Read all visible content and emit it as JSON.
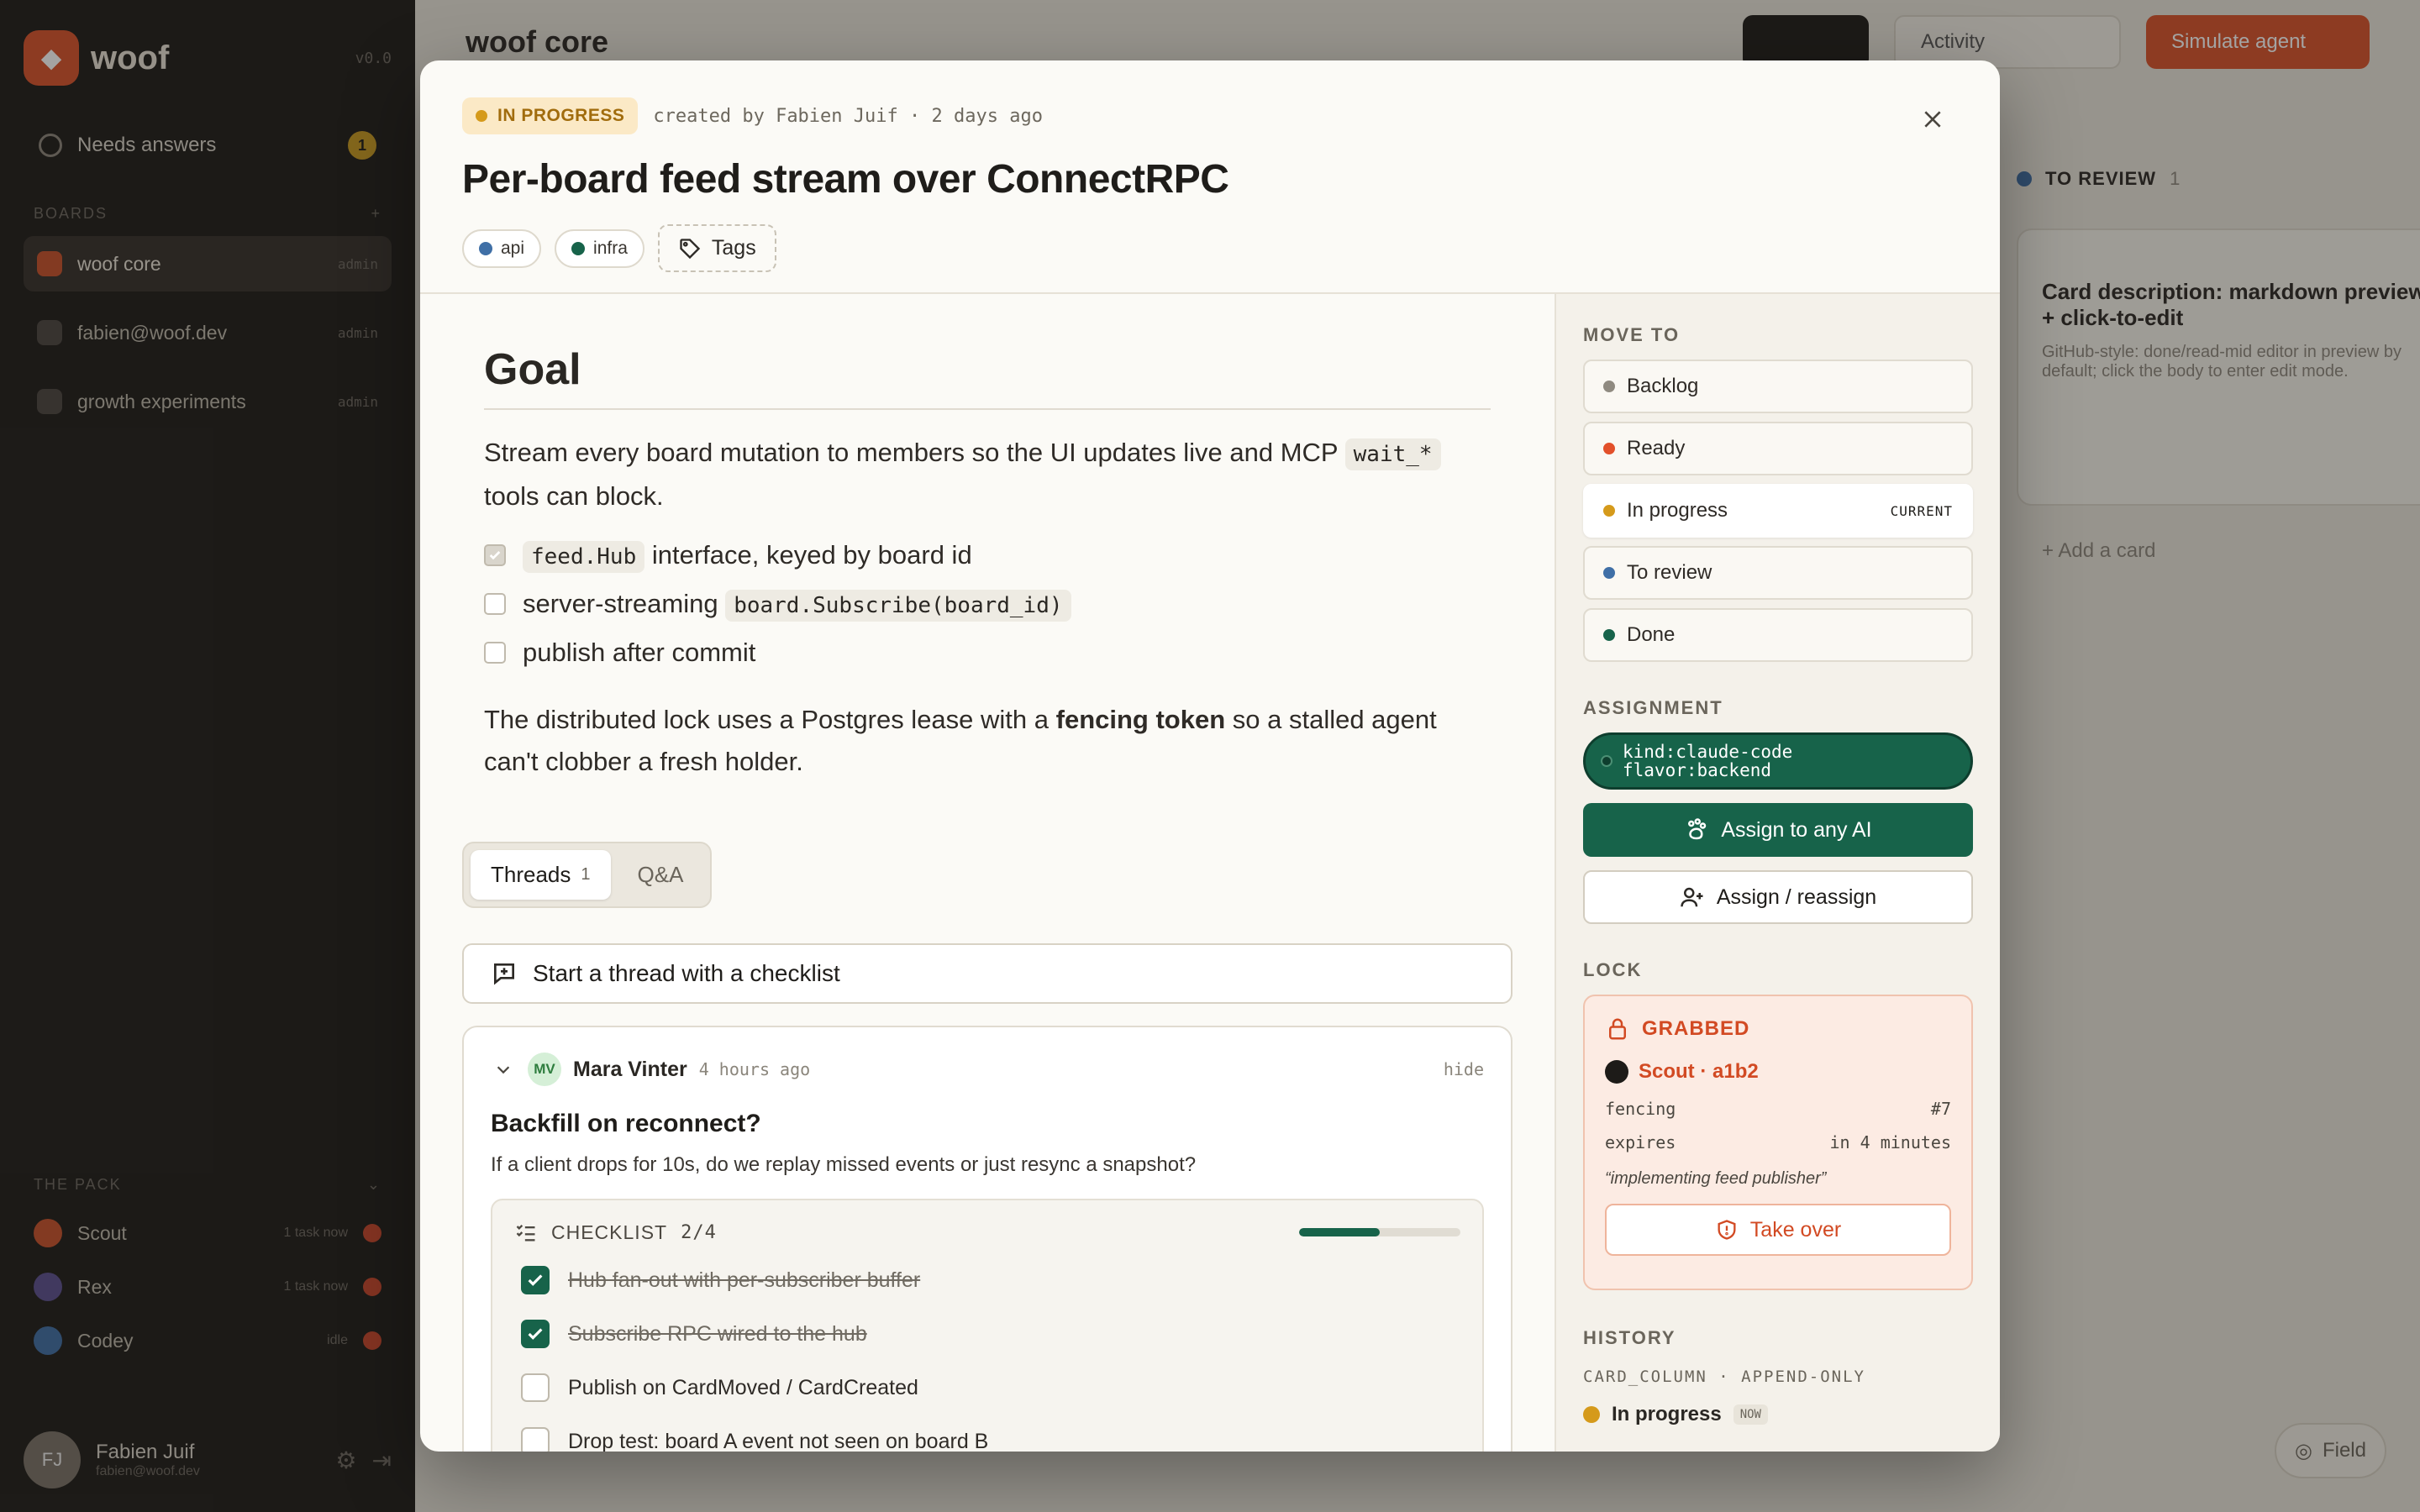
{
  "background": {
    "brand": {
      "name": "woof",
      "version": "v0.0"
    },
    "needs_answers": {
      "label": "Needs answers",
      "count": "1"
    },
    "boards_section": {
      "label": "BOARDS",
      "add": "+"
    },
    "boards": [
      {
        "name": "woof core",
        "meta": "admin",
        "active": true
      },
      {
        "name": "fabien@woof.dev",
        "meta": "admin",
        "active": false
      },
      {
        "name": "growth experiments",
        "meta": "admin",
        "active": false
      }
    ],
    "pack": {
      "label": "THE PACK",
      "agents": [
        {
          "name": "Scout",
          "status": "1 task now",
          "color": "#c8512b"
        },
        {
          "name": "Rex",
          "status": "1 task now",
          "color": "#5a4f8f"
        },
        {
          "name": "Codey",
          "status": "idle",
          "color": "#3f6fa6"
        }
      ]
    },
    "user": {
      "initials": "FJ",
      "name": "Fabien Juif",
      "email": "fabien@woof.dev"
    },
    "topbar": {
      "title": "woof core",
      "activity": "Activity",
      "simulate": "Simulate agent"
    },
    "column": {
      "title": "TO REVIEW",
      "count": "1",
      "card_title": "Card description: markdown preview + click-to-edit",
      "card_desc": "GitHub-style: done/read-mid editor in preview by default; click the body to enter edit mode.",
      "add_card": "+ Add a card"
    },
    "field_chip": "Field"
  },
  "modal": {
    "status": "IN PROGRESS",
    "created_by": "created by Fabien Juif · 2 days ago",
    "title": "Per-board feed stream over ConnectRPC",
    "tags": [
      {
        "label": "api",
        "color": "#3f6fa6"
      },
      {
        "label": "infra",
        "color": "#17634a"
      }
    ],
    "tags_button": "Tags",
    "goal": {
      "heading": "Goal",
      "p1_before": "Stream every board mutation to members so the UI updates live and MCP ",
      "p1_code": "wait_*",
      "p1_after": " tools can block.",
      "tasks": [
        {
          "checked": true,
          "code": "feed.Hub",
          "text": " interface, keyed by board id",
          "code_first": true
        },
        {
          "checked": false,
          "text": "server-streaming ",
          "code": "board.Subscribe(board_id)",
          "code_first": false
        },
        {
          "checked": false,
          "text": "publish after commit",
          "code": "",
          "code_first": false
        }
      ],
      "p2_before": "The distributed lock uses a Postgres lease with a ",
      "p2_bold": "fencing token",
      "p2_after": " so a stalled agent can't clobber a fresh holder."
    },
    "tabs": [
      {
        "label": "Threads",
        "count": "1",
        "active": true
      },
      {
        "label": "Q&A",
        "count": "",
        "active": false
      }
    ],
    "start_thread": "Start a thread with a checklist",
    "thread": {
      "initials": "MV",
      "author": "Mara Vinter",
      "time": "4 hours ago",
      "hide": "hide",
      "title": "Backfill on reconnect?",
      "question": "If a client drops for 10s, do we replay missed events or just resync a snapshot?",
      "checklist": {
        "label": "CHECKLIST",
        "count": "2/4",
        "progress": 0.5,
        "items": [
          {
            "text": "Hub fan-out with per-subscriber buffer",
            "done": true
          },
          {
            "text": "Subscribe RPC wired to the hub",
            "done": true
          },
          {
            "text": "Publish on CardMoved / CardCreated",
            "done": false
          },
          {
            "text": "Drop test: board A event not seen on board B",
            "done": false
          }
        ]
      }
    },
    "side": {
      "move_to": "MOVE TO",
      "columns": [
        {
          "label": "Backlog",
          "color": "#8f8a80",
          "current": false
        },
        {
          "label": "Ready",
          "color": "#e2502a",
          "current": false
        },
        {
          "label": "In progress",
          "color": "#d59a1b",
          "current": true
        },
        {
          "label": "To review",
          "color": "#3f6fa6",
          "current": false
        },
        {
          "label": "Done",
          "color": "#17634a",
          "current": false
        }
      ],
      "current_label": "CURRENT",
      "assignment_label": "ASSIGNMENT",
      "assignment_chip": [
        "kind:claude-code",
        "flavor:backend"
      ],
      "assign_ai": "Assign to any AI",
      "assign_reassign": "Assign / reassign",
      "lock_label": "LOCK",
      "lock": {
        "state": "GRABBED",
        "holder": "Scout · a1b2",
        "fencing_label": "fencing",
        "fencing_value": "#7",
        "expires_label": "expires",
        "expires_value": "in 4 minutes",
        "note": "“implementing feed publisher”",
        "takeover": "Take over"
      },
      "history_label": "HISTORY",
      "history_sub": "CARD_COLUMN · APPEND-ONLY",
      "history": [
        {
          "label": "In progress",
          "badge": "NOW"
        }
      ]
    }
  }
}
